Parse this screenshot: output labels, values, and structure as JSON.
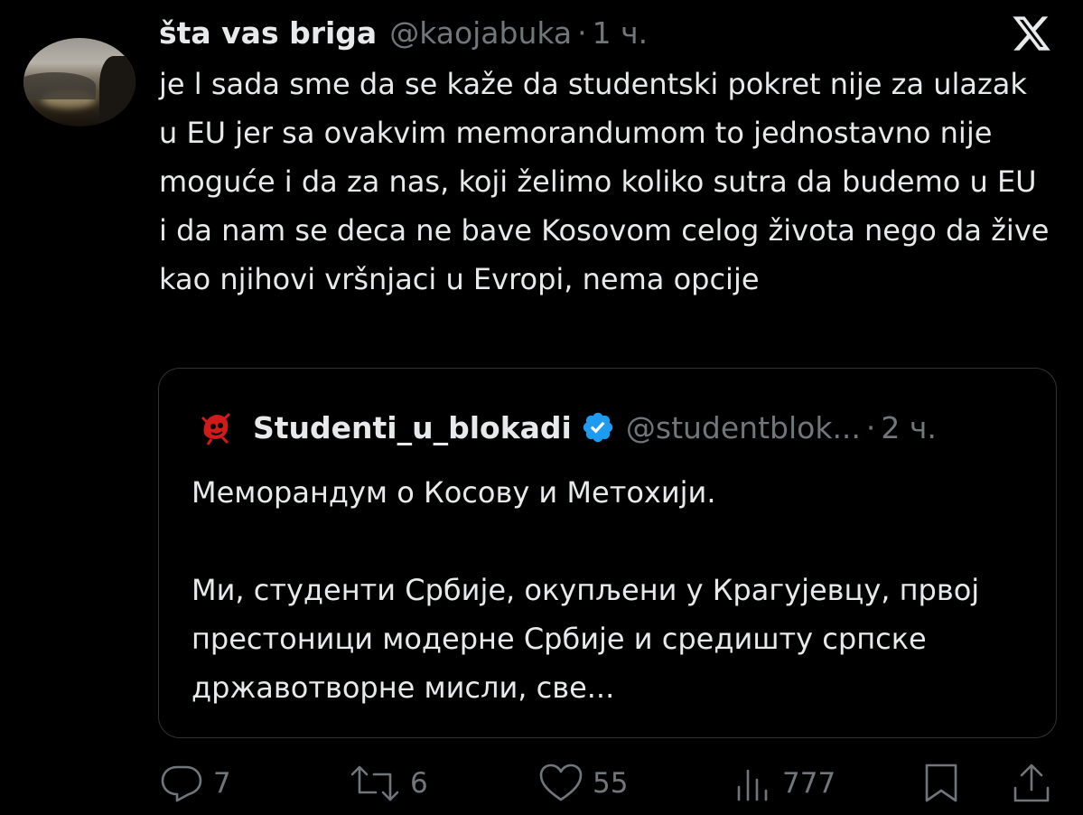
{
  "tweet": {
    "author_name": "šta vas briga",
    "handle": "@kaojabuka",
    "separator": "·",
    "time": "1 ч.",
    "text": "je l sada sme da se kaže da studentski pokret nije za ulazak u EU jer sa ovakvim memorandumom to jednostavno nije moguće i da za nas, koji želimo koliko sutra da budemo u EU i da nam se deca ne bave Kosovom celog života nego da žive kao njihovi vršnjaci u Evropi, nema opcije"
  },
  "quote": {
    "author_name": "Studenti_u_blokadi",
    "handle": "@studentblok...",
    "separator": "·",
    "time": "2 ч.",
    "verified": true,
    "text": "Меморандум о Косову и Метохији.\n\nМи, студенти Србије, окупљени у Крагујевцу, првој престоници модерне Србије и средишту српске државотворне мисли, све..."
  },
  "actions": {
    "replies": "7",
    "reposts": "6",
    "likes": "55",
    "views": "777"
  },
  "colors": {
    "background": "#000000",
    "text": "#e7e9ea",
    "muted": "#71767b",
    "verified": "#1d9bf0",
    "border": "#2f3336"
  },
  "icons": [
    "x-logo-icon",
    "verified-badge-icon",
    "reply-icon",
    "repost-icon",
    "like-icon",
    "views-icon",
    "bookmark-icon",
    "share-icon"
  ]
}
